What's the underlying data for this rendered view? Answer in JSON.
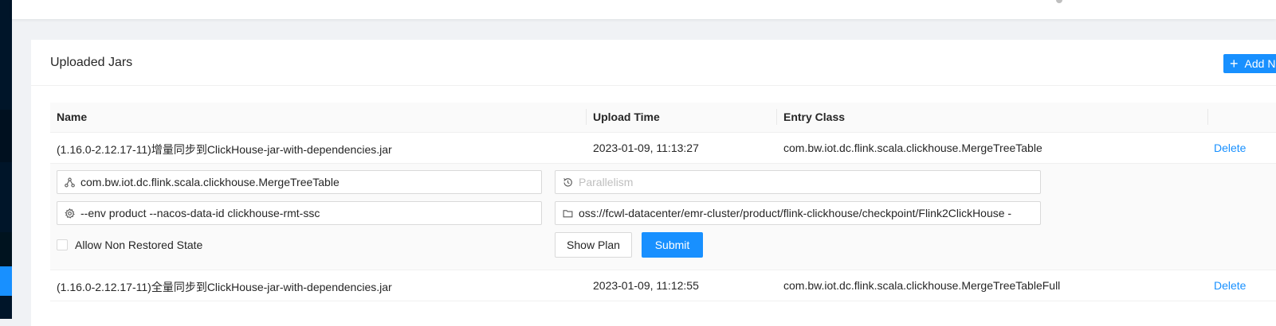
{
  "card": {
    "title": "Uploaded Jars",
    "add_button_label": "Add N"
  },
  "table": {
    "columns": [
      "Name",
      "Upload Time",
      "Entry Class"
    ],
    "rows": [
      {
        "name": "(1.16.0-2.12.17-11)增量同步到ClickHouse-jar-with-dependencies.jar",
        "upload_time": "2023-01-09, 11:13:27",
        "entry_class": "com.bw.iot.dc.flink.scala.clickhouse.MergeTreeTable",
        "action": "Delete"
      },
      {
        "name": "(1.16.0-2.12.17-11)全量同步到ClickHouse-jar-with-dependencies.jar",
        "upload_time": "2023-01-09, 11:12:55",
        "entry_class": "com.bw.iot.dc.flink.scala.clickhouse.MergeTreeTableFull",
        "action": "Delete"
      }
    ]
  },
  "expanded": {
    "entry_class_value": "com.bw.iot.dc.flink.scala.clickhouse.MergeTreeTable",
    "parallelism_placeholder": "Parallelism",
    "program_args_value": "--env product --nacos-data-id clickhouse-rmt-ssc",
    "savepoint_path_value": "oss://fcwl-datacenter/emr-cluster/product/flink-clickhouse/checkpoint/Flink2ClickHouse -",
    "allow_non_restored_label": "Allow Non Restored State",
    "allow_non_restored_checked": false,
    "show_plan_label": "Show Plan",
    "submit_label": "Submit"
  },
  "colors": {
    "primary": "#1890ff",
    "sidebar": "#001529"
  }
}
